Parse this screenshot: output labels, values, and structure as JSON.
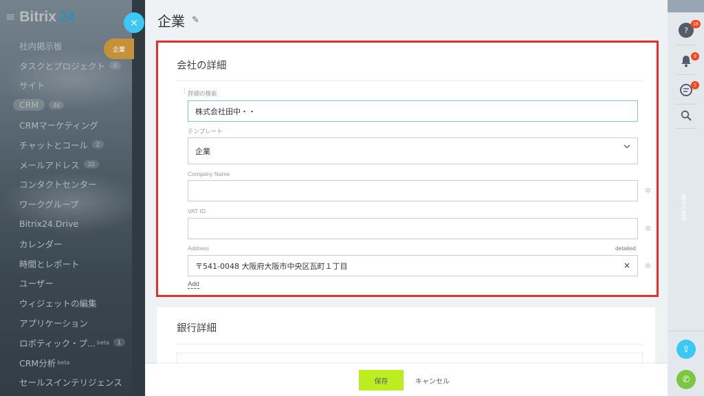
{
  "sidebar": {
    "logo": "Bitrix",
    "logo_num": "24",
    "items": [
      {
        "label": "社内掲示板"
      },
      {
        "label": "タスクとプロジェクト",
        "badge": "6"
      },
      {
        "label": "サイト"
      },
      {
        "label": "CRM",
        "badge": "44"
      },
      {
        "label": "CRMマーケティング"
      },
      {
        "label": "チャットとコール",
        "badge": "2"
      },
      {
        "label": "メールアドレス",
        "badge": "33"
      },
      {
        "label": "コンタクトセンター"
      },
      {
        "label": "ワークグループ"
      },
      {
        "label": "Bitrix24.Drive"
      },
      {
        "label": "カレンダー"
      },
      {
        "label": "時間とレポート"
      },
      {
        "label": "ユーザー"
      },
      {
        "label": "ウィジェットの編集"
      },
      {
        "label": "アプリケーション"
      },
      {
        "label": "ロボティック・プ...",
        "sup": "beta",
        "badge": "1"
      },
      {
        "label": "CRM分析",
        "sup": "beta"
      },
      {
        "label": "セールスインテリジェンス"
      }
    ]
  },
  "slider": {
    "close_icon": "×",
    "company_tag": "企業",
    "title": "企業",
    "edit_icon": "✎"
  },
  "card1": {
    "title": "会社の詳細",
    "search_label": "詳細の検索",
    "search_value": "株式会社田中・・",
    "template_label": "テンプレート",
    "template_value": "企業",
    "company_name_label": "Company Name",
    "company_name_value": "",
    "vat_label": "VAT ID",
    "vat_value": "",
    "address_label": "Address",
    "address_detailed": "detailed",
    "address_value": "〒541-0048 大阪府大阪市中央区瓦町１丁目",
    "address_clear": "×",
    "add_link": "Add",
    "gear_icon": "✲"
  },
  "card2": {
    "title": "銀行詳細"
  },
  "footer": {
    "save": "保存",
    "cancel": "キャンセル"
  },
  "rail": {
    "help_badge": "16",
    "notif_badge": "9",
    "chat_badge": "2",
    "vertical_text": "最近の連絡"
  },
  "colors": {
    "accent": "#3bc8f5",
    "save": "#bbed21",
    "highlight": "#e3302a",
    "badge": "#f54819"
  }
}
